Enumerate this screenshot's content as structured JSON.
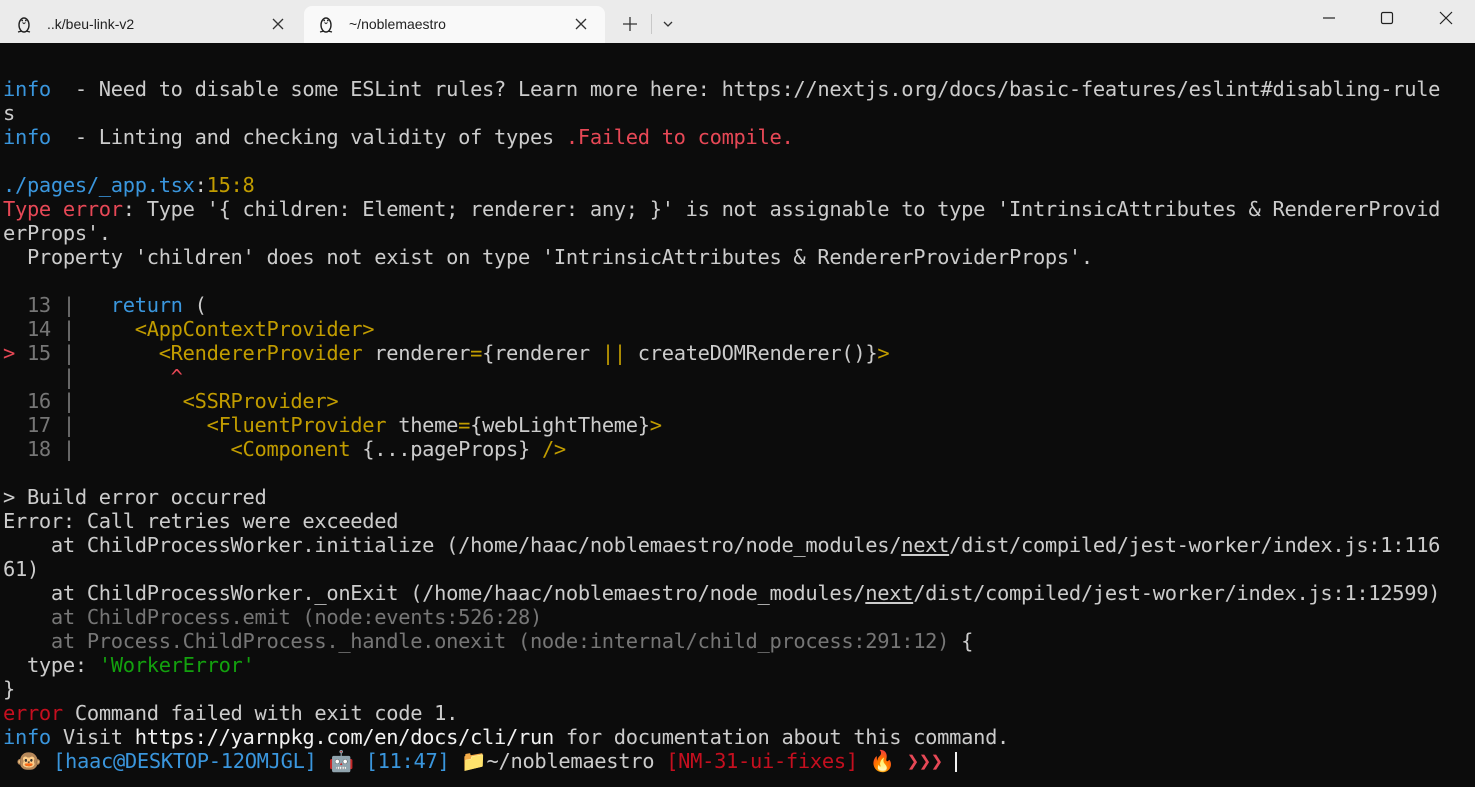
{
  "window": {
    "tabs": [
      {
        "title": "..k/beu-link-v2",
        "icon": "linux-penguin-icon"
      },
      {
        "title": "~/noblemaestro",
        "icon": "linux-penguin-icon"
      }
    ],
    "controls": {
      "new_tab": "+",
      "dropdown": "chevron-down-icon",
      "minimize": "minimize-icon",
      "maximize": "maximize-icon",
      "close": "close-icon"
    }
  },
  "terminal": {
    "l1_tag": "info",
    "l1_text": "  - Need to disable some ESLint rules? Learn more here: https://nextjs.org/docs/basic-features/eslint#disabling-rule",
    "l2_text": "s",
    "l3_tag": "info",
    "l3_text": "  - Linting and checking validity of types ",
    "l3_fail": ".Failed to compile.",
    "file_path": "./pages/_app.tsx",
    "file_sep": ":",
    "file_loc": "15:8",
    "err_label": "Type error",
    "err_text1": ": Type '{ children: Element; renderer: any; }' is not assignable to type 'IntrinsicAttributes & RendererProvid",
    "err_text2": "erProps'.",
    "err_text3": "  Property 'children' does not exist on type 'IntrinsicAttributes & RendererProviderProps'.",
    "code": {
      "l13_num": "  13 |",
      "l13_kw": "   return",
      "l13_rest": " (",
      "l14_num": "  14 |",
      "l14_tag": "     <AppContextProvider>",
      "l15_marker": ">",
      "l15_num": " 15 |",
      "l15_tag": "       <RendererProvider",
      "l15_attr": " renderer",
      "l15_eq": "=",
      "l15_b1": "{renderer ",
      "l15_or": "||",
      "l15_b2": " createDOMRenderer()}",
      "l15_end": ">",
      "caret_bar": "     |",
      "caret": "        ^",
      "l16_num": "  16 |",
      "l16_tag": "         <SSRProvider>",
      "l17_num": "  17 |",
      "l17_tag": "           <FluentProvider",
      "l17_attr": " theme",
      "l17_eq": "=",
      "l17_val": "{webLightTheme}",
      "l17_end": ">",
      "l18_num": "  18 |",
      "l18_tag": "             <Component",
      "l18_val": " {...pageProps} ",
      "l18_end": "/>"
    },
    "build_err": "> Build error occurred",
    "err_line": "Error: Call retries were exceeded",
    "at1_pre": "    at ChildProcessWorker.initialize (/home/haac/noblemaestro/node_modules/",
    "at1_link": "next",
    "at1_post": "/dist/compiled/jest-worker/index.js:1:116",
    "at1_cont": "61)",
    "at2_pre": "    at ChildProcessWorker._onExit (/home/haac/noblemaestro/node_modules/",
    "at2_link": "next",
    "at2_post": "/dist/compiled/jest-worker/index.js:1:12599)",
    "at3": "    at ChildProcess.emit (node:events:526:28)",
    "at4": "    at Process.ChildProcess._handle.onexit (node:internal/child_process:291:12)",
    "at4_brace": " {",
    "type_label": "  type: ",
    "type_val": "'WorkerError'",
    "close_brace": "}",
    "error_tag": "error",
    "error_text": " Command failed with exit code 1.",
    "info_tag": "info",
    "info_text": " Visit ",
    "info_url": "https://yarnpkg.com/en/docs/cli/run",
    "info_rest": " for documentation about this command."
  },
  "prompt": {
    "monkey": "🐵",
    "user_host": " [haac@DESKTOP-12OMJGL] ",
    "robot": "🤖",
    "time": " [11:47] ",
    "folder": "📁",
    "path": "~/noblemaestro ",
    "branch": "[NM-31-ui-fixes]",
    "fire": " 🔥 ",
    "arrows": "❯❯❯ "
  }
}
